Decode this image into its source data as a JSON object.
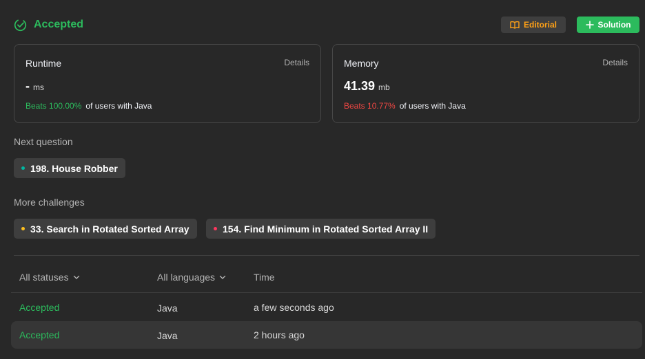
{
  "header": {
    "status": "Accepted",
    "editorial_label": "Editorial",
    "solution_label": "Solution"
  },
  "runtime": {
    "label": "Runtime",
    "details": "Details",
    "value": "-",
    "unit": "ms",
    "beats": "Beats 100.00%",
    "beats_suffix": "of users with Java"
  },
  "memory": {
    "label": "Memory",
    "details": "Details",
    "value": "41.39",
    "unit": "mb",
    "beats": "Beats 10.77%",
    "beats_suffix": "of users with Java"
  },
  "next_question": {
    "label": "Next question",
    "item": {
      "title": "198. House Robber",
      "dot_color": "#00b8a3"
    }
  },
  "more_challenges": {
    "label": "More challenges",
    "items": [
      {
        "title": "33. Search in Rotated Sorted Array",
        "dot_color": "#ffc01e"
      },
      {
        "title": "154. Find Minimum in Rotated Sorted Array II",
        "dot_color": "#ff375f"
      }
    ]
  },
  "table": {
    "headers": {
      "status": "All statuses",
      "language": "All languages",
      "time": "Time"
    },
    "rows": [
      {
        "status": "Accepted",
        "language": "Java",
        "time": "a few seconds ago"
      },
      {
        "status": "Accepted",
        "language": "Java",
        "time": "2 hours ago"
      }
    ]
  },
  "colors": {
    "accepted": "#2cbb5d",
    "editorial": "#ffa116",
    "beats_good": "#2cbb5d",
    "beats_bad": "#ef4743"
  }
}
